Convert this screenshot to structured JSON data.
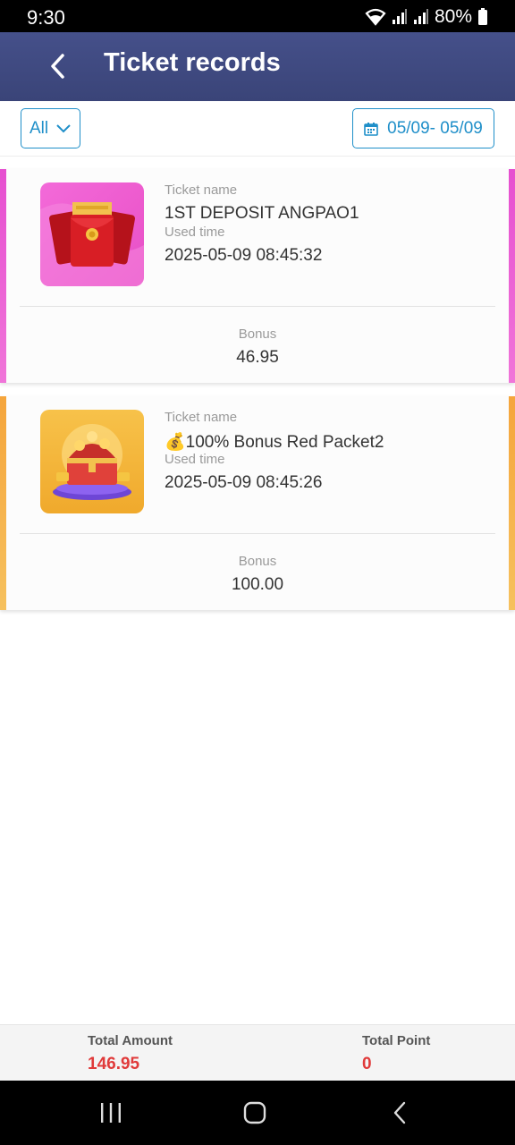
{
  "status_bar": {
    "time": "9:30",
    "battery": "80%",
    "icons": [
      "wifi-icon",
      "signal-icon",
      "signal-icon",
      "battery-icon"
    ]
  },
  "header": {
    "title": "Ticket records",
    "back_icon": "chevron-left-icon",
    "color": "#3f4a82"
  },
  "filters": {
    "type_selected": "All",
    "date_range": "05/09- 05/09",
    "accent": "#1f8fc9"
  },
  "tickets": [
    {
      "name_label": "Ticket name",
      "name": "1ST DEPOSIT ANGPAO1",
      "time_label": "Used time",
      "time": "2025-05-09 08:45:32",
      "bonus_label": "Bonus",
      "bonus": "46.95",
      "icon": "red-envelope-icon",
      "edge_color": "#e64fd0"
    },
    {
      "name_label": "Ticket name",
      "name": "💰100% Bonus Red Packet2",
      "time_label": "Used time",
      "time": "2025-05-09 08:45:26",
      "bonus_label": "Bonus",
      "bonus": "100.00",
      "icon": "treasure-chest-icon",
      "edge_color": "#f5a53c"
    }
  ],
  "footer": {
    "total_amount_label": "Total Amount",
    "total_amount": "146.95",
    "total_point_label": "Total Point",
    "total_point": "0",
    "value_color": "#e03a3a"
  },
  "nav_bar": {
    "buttons": [
      "recent-apps-icon",
      "home-icon",
      "back-icon"
    ]
  }
}
